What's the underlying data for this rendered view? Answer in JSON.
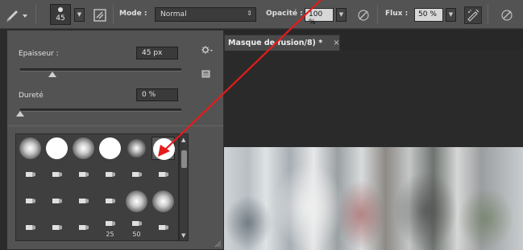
{
  "options_bar": {
    "brush_size": "45",
    "mode_label": "Mode :",
    "mode_value": "Normal",
    "opacity_label": "Opacité :",
    "opacity_value": "100 %",
    "flow_label": "Flux :",
    "flow_value": "50 %"
  },
  "brush_panel": {
    "size_label": "Epaisseur :",
    "size_value": "45 px",
    "size_fraction": 0.2,
    "hardness_label": "Dureté",
    "hardness_value": "0 %",
    "hardness_fraction": 0.0,
    "presets": [
      {
        "row": 0,
        "col": 0,
        "kind": "soft-round"
      },
      {
        "row": 0,
        "col": 1,
        "kind": "hard-round"
      },
      {
        "row": 0,
        "col": 2,
        "kind": "soft-round"
      },
      {
        "row": 0,
        "col": 3,
        "kind": "hard-round"
      },
      {
        "row": 0,
        "col": 4,
        "kind": "soft-round-small"
      },
      {
        "row": 0,
        "col": 5,
        "kind": "hard-round",
        "selected": true
      },
      {
        "row": 1,
        "col": 0,
        "kind": "tip"
      },
      {
        "row": 1,
        "col": 1,
        "kind": "tip"
      },
      {
        "row": 1,
        "col": 2,
        "kind": "tip"
      },
      {
        "row": 1,
        "col": 3,
        "kind": "tip"
      },
      {
        "row": 1,
        "col": 4,
        "kind": "tip"
      },
      {
        "row": 1,
        "col": 5,
        "kind": "tip"
      },
      {
        "row": 2,
        "col": 0,
        "kind": "tip"
      },
      {
        "row": 2,
        "col": 1,
        "kind": "tip"
      },
      {
        "row": 2,
        "col": 2,
        "kind": "tip"
      },
      {
        "row": 2,
        "col": 3,
        "kind": "tip"
      },
      {
        "row": 2,
        "col": 4,
        "kind": "soft-round"
      },
      {
        "row": 2,
        "col": 5,
        "kind": "soft-round"
      },
      {
        "row": 3,
        "col": 0,
        "kind": "tip"
      },
      {
        "row": 3,
        "col": 1,
        "kind": "tip"
      },
      {
        "row": 3,
        "col": 2,
        "kind": "tip"
      },
      {
        "row": 3,
        "col": 3,
        "kind": "tip",
        "label": "25"
      },
      {
        "row": 3,
        "col": 4,
        "kind": "tip",
        "label": "50"
      },
      {
        "row": 3,
        "col": 5,
        "kind": "tip"
      }
    ]
  },
  "document": {
    "tab_title": "Masque de fusion/8) *",
    "close_glyph": "×"
  },
  "colors": {
    "annotation_arrow": "#e51b1b"
  }
}
